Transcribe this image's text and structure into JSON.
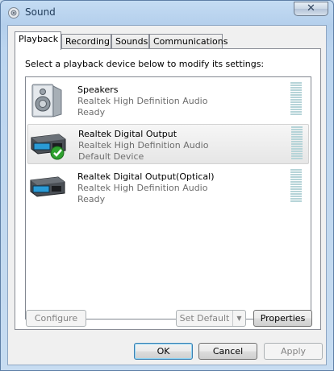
{
  "window": {
    "title": "Sound",
    "close_glyph": "✕"
  },
  "tabs": [
    {
      "label": "Playback",
      "active": true
    },
    {
      "label": "Recording",
      "active": false
    },
    {
      "label": "Sounds",
      "active": false
    },
    {
      "label": "Communications",
      "active": false
    }
  ],
  "panel": {
    "instruction": "Select a playback device below to modify its settings:"
  },
  "devices": [
    {
      "name": "Speakers",
      "description": "Realtek High Definition Audio",
      "status": "Ready",
      "icon": "speaker-icon",
      "selected": false,
      "is_default": false
    },
    {
      "name": "Realtek Digital Output",
      "description": "Realtek High Definition Audio",
      "status": "Default Device",
      "icon": "digital-output-icon",
      "selected": true,
      "is_default": true
    },
    {
      "name": "Realtek Digital Output(Optical)",
      "description": "Realtek High Definition Audio",
      "status": "Ready",
      "icon": "digital-output-icon",
      "selected": false,
      "is_default": false
    }
  ],
  "buttons": {
    "configure": "Configure",
    "set_default": "Set Default",
    "properties": "Properties",
    "ok": "OK",
    "cancel": "Cancel",
    "apply": "Apply"
  },
  "colors": {
    "titlebar": "#c4dcf3",
    "selection": "#e6e6e6",
    "meter": "#b6d4d8",
    "default_check": "#2fa12f"
  }
}
